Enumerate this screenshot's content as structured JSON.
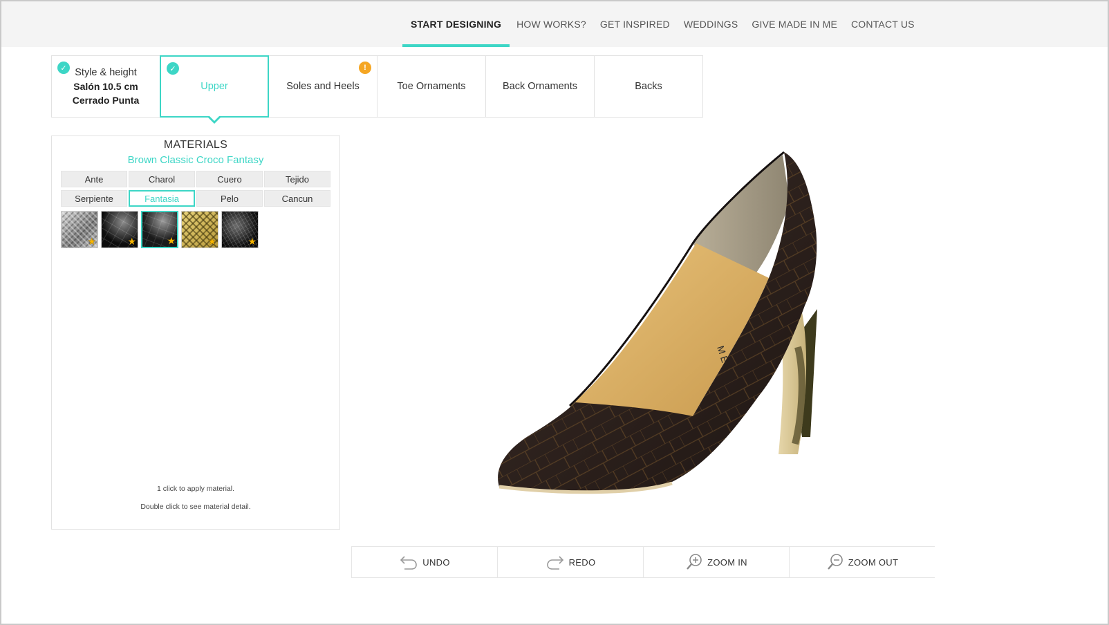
{
  "nav": {
    "items": [
      {
        "label": "START DESIGNING",
        "active": true
      },
      {
        "label": "HOW WORKS?",
        "active": false
      },
      {
        "label": "GET INSPIRED",
        "active": false
      },
      {
        "label": "WEDDINGS",
        "active": false
      },
      {
        "label": "GIVE MADE IN ME",
        "active": false
      },
      {
        "label": "CONTACT US",
        "active": false
      }
    ]
  },
  "steps": [
    {
      "title": "Style & height",
      "subtitle": "Salón 10.5 cm Cerrado Punta",
      "status": "done",
      "status_icon": "check-icon"
    },
    {
      "title": "Upper",
      "status": "done",
      "status_icon": "check-icon",
      "active": true
    },
    {
      "title": "Soles and Heels",
      "status": "warning",
      "status_icon": "exclamation-icon"
    },
    {
      "title": "Toe Ornaments"
    },
    {
      "title": "Back Ornaments"
    },
    {
      "title": "Backs"
    }
  ],
  "materials": {
    "title": "MATERIALS",
    "selected_name": "Brown Classic Croco Fantasy",
    "categories": [
      "Ante",
      "Charol",
      "Cuero",
      "Tejido",
      "Serpiente",
      "Fantasia",
      "Pelo",
      "Cancun"
    ],
    "active_category": "Fantasia",
    "swatches": [
      {
        "icon": "star-icon",
        "selected": false
      },
      {
        "icon": "star-icon",
        "selected": false
      },
      {
        "icon": "star-icon",
        "selected": true
      },
      {
        "icon": "star-icon",
        "selected": false
      },
      {
        "icon": "star-icon",
        "selected": false
      }
    ],
    "hint_apply": "1 click to apply material.",
    "hint_detail": "Double click to see material detail."
  },
  "toolbar": {
    "undo_label": "UNDO",
    "redo_label": "REDO",
    "zoom_in_label": "ZOOM IN",
    "zoom_out_label": "ZOOM OUT"
  },
  "shoe": {
    "insole_text": "M E"
  },
  "colors": {
    "accent": "#3dd6c6",
    "warning": "#f5a623",
    "star": "#f7b500",
    "upper_leather": "#2c211d",
    "insole": "#d9b066"
  }
}
